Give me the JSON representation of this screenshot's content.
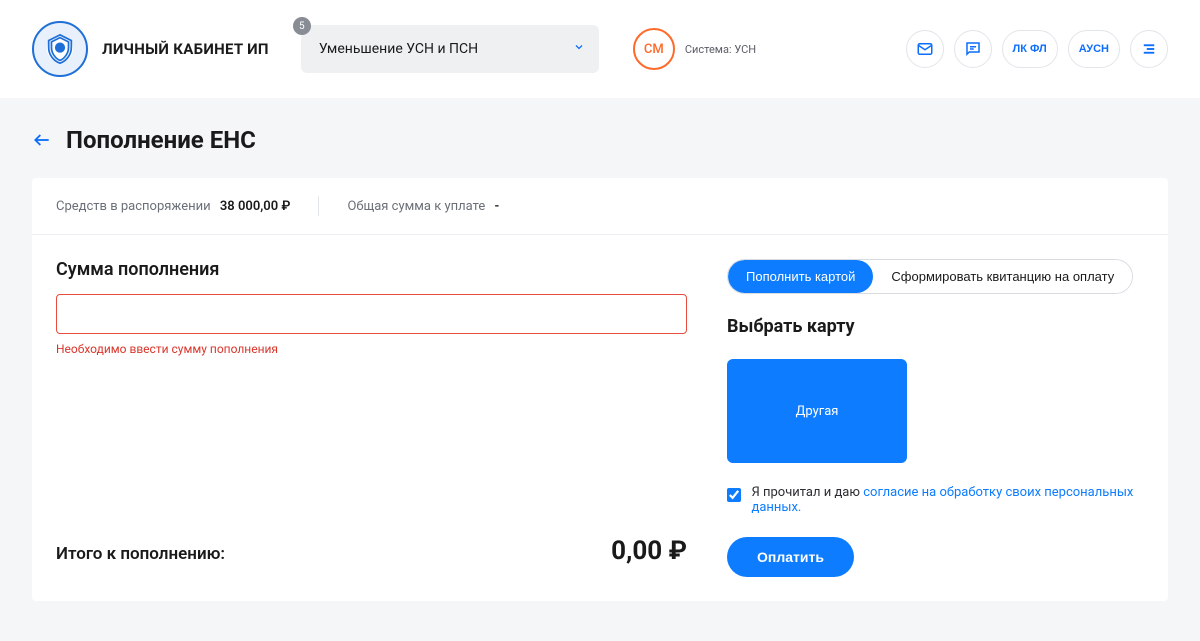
{
  "header": {
    "app_title": "ЛИЧНЫЙ КАБИНЕТ ИП",
    "notification_count": "5",
    "notification_text": "Уменьшение УСН и ПСН",
    "avatar_initials": "СМ",
    "system_label": "Система: УСН",
    "nav_lkfl": "ЛК ФЛ",
    "nav_ausn": "АУСН"
  },
  "page": {
    "title": "Пополнение ЕНС"
  },
  "summary": {
    "funds_label": "Средств в распоряжении",
    "funds_value": "38 000,00 ₽",
    "total_pay_label": "Общая сумма к уплате",
    "total_pay_value": "-"
  },
  "form": {
    "amount_label": "Сумма пополнения",
    "amount_value": "",
    "amount_error": "Необходимо ввести сумму пополнения",
    "total_label": "Итого к пополнению:",
    "total_value": "0,00 ₽"
  },
  "right": {
    "tab_card": "Пополнить картой",
    "tab_receipt": "Сформировать квитанцию на оплату",
    "choose_card_label": "Выбрать карту",
    "card_other": "Другая",
    "consent_prefix": "Я прочитал и даю ",
    "consent_link": "согласие на обработку своих персональных данных.",
    "pay_button": "Оплатить"
  }
}
